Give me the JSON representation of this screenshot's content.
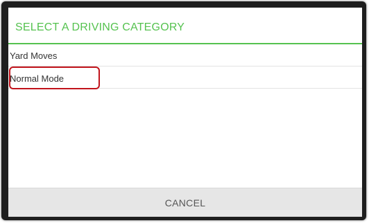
{
  "dialog": {
    "title": "SELECT A DRIVING CATEGORY",
    "items": [
      {
        "label": "Yard Moves"
      },
      {
        "label": "Normal Mode"
      }
    ],
    "cancel_label": "CANCEL"
  },
  "colors": {
    "accent": "#55c24f",
    "highlight_outline": "#c1131b",
    "frame": "#1e1e1e",
    "footer_bg": "#e6e6e6"
  }
}
